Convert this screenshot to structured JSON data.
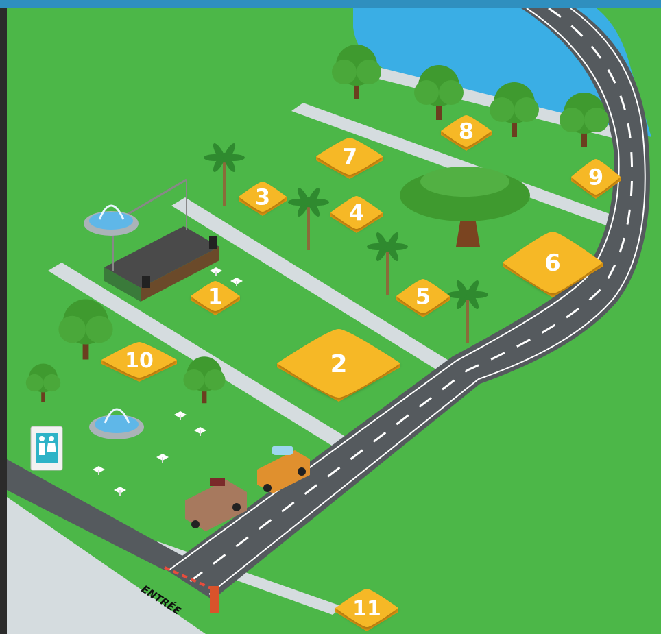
{
  "map": {
    "entrance_label": "ENTRÉE",
    "restroom_icon": "restroom-icon",
    "colors": {
      "grass": "#4cb748",
      "path": "#d5dcdf",
      "road": "#555a5e",
      "road_line": "#ffffff",
      "water": "#3aaee5",
      "marker": "#f6b825",
      "marker_dark": "#e49a12",
      "frame": "#2b2b2b",
      "top_band": "#2f8fbf"
    },
    "markers": [
      {
        "id": 1,
        "label": "1"
      },
      {
        "id": 2,
        "label": "2"
      },
      {
        "id": 3,
        "label": "3"
      },
      {
        "id": 4,
        "label": "4"
      },
      {
        "id": 5,
        "label": "5"
      },
      {
        "id": 6,
        "label": "6"
      },
      {
        "id": 7,
        "label": "7"
      },
      {
        "id": 8,
        "label": "8"
      },
      {
        "id": 9,
        "label": "9"
      },
      {
        "id": 10,
        "label": "10"
      },
      {
        "id": 11,
        "label": "11"
      }
    ],
    "features": [
      "stage",
      "fountain",
      "fountain",
      "food-truck",
      "food-truck",
      "barrier-gate",
      "lake",
      "picnic-tables"
    ]
  }
}
